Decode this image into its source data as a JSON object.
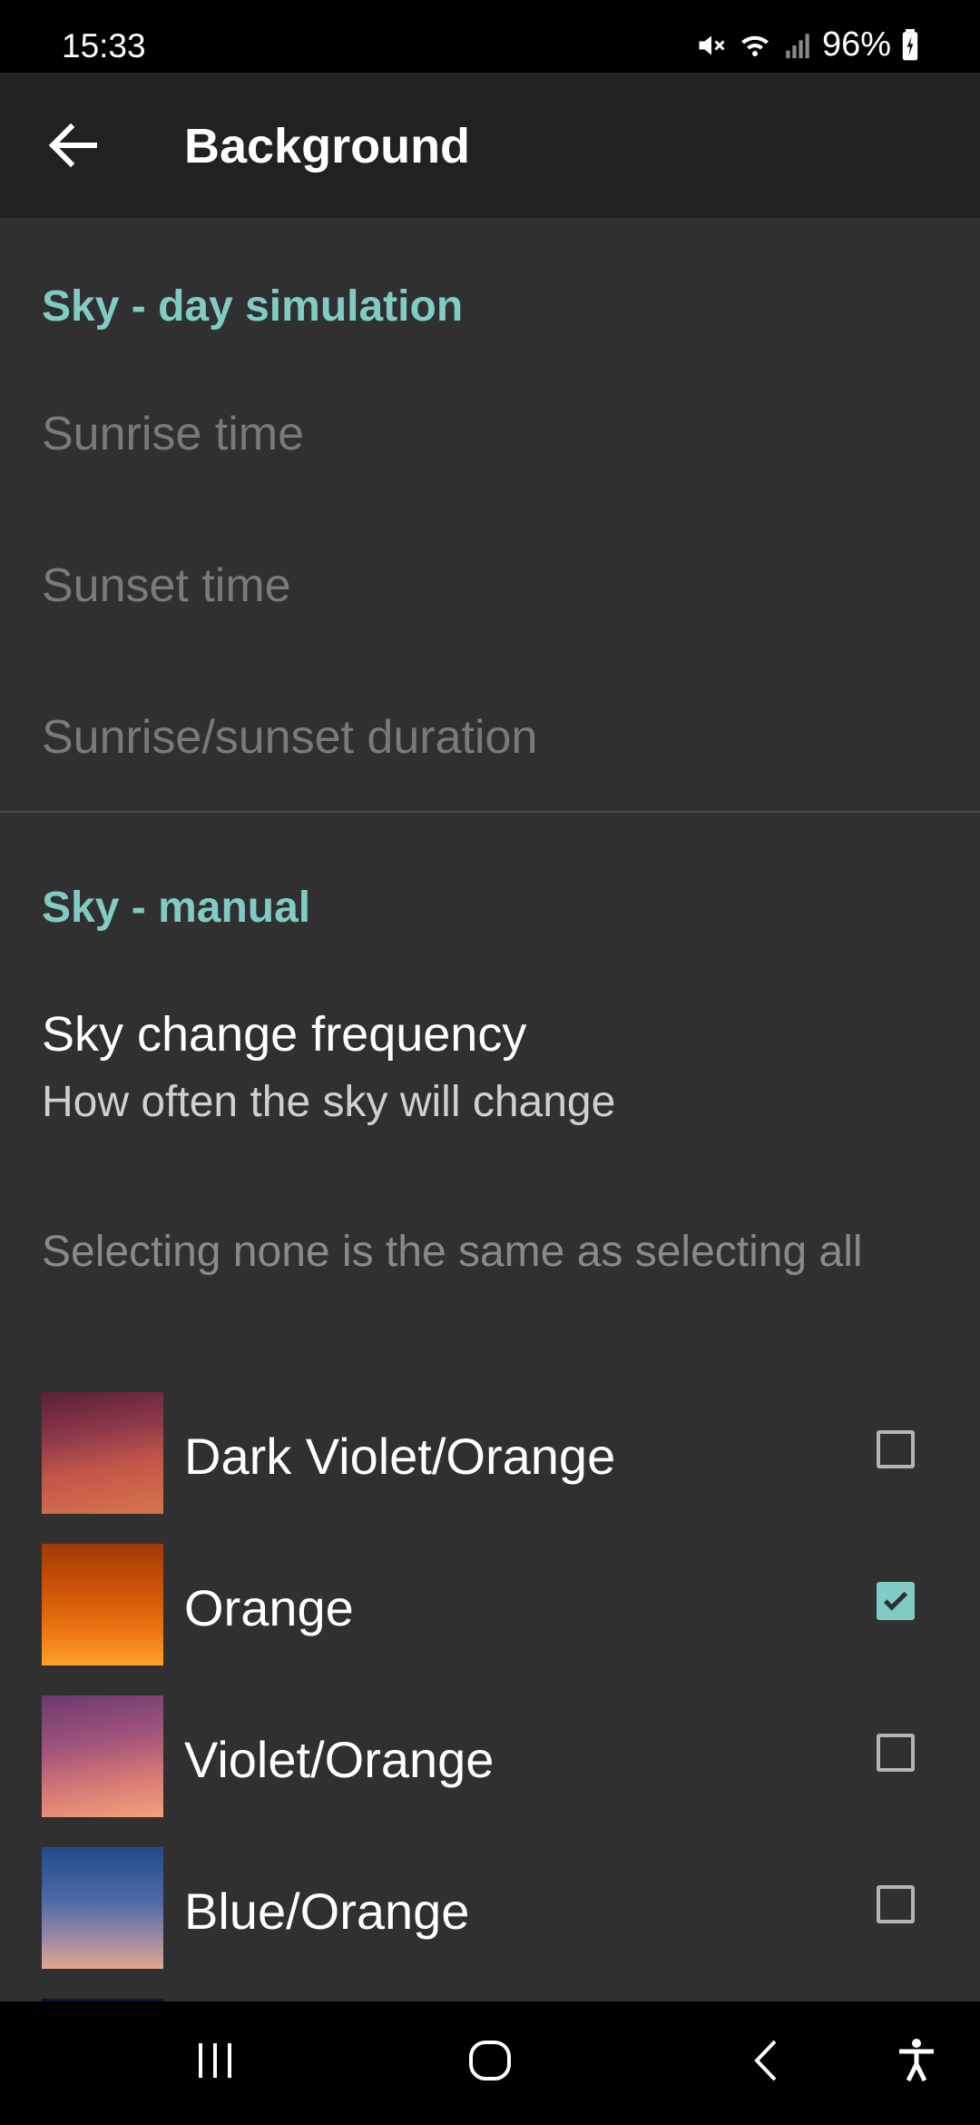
{
  "status": {
    "time": "15:33",
    "battery": "96%"
  },
  "appbar": {
    "title": "Background"
  },
  "sections": {
    "day_simulation": {
      "header": "Sky - day simulation",
      "sunrise": "Sunrise time",
      "sunset": "Sunset time",
      "duration": "Sunrise/sunset duration"
    },
    "manual": {
      "header": "Sky - manual",
      "frequency_title": "Sky change frequency",
      "frequency_summary": "How often the sky will change",
      "note": "Selecting none is the same as selecting all"
    }
  },
  "skies": [
    {
      "label": "Dark Violet/Orange",
      "checked": false
    },
    {
      "label": "Orange",
      "checked": true
    },
    {
      "label": "Violet/Orange",
      "checked": false
    },
    {
      "label": "Blue/Orange",
      "checked": false
    }
  ],
  "colors": {
    "accent": "#80cbc4",
    "background": "#303030",
    "appbar": "#212121"
  }
}
